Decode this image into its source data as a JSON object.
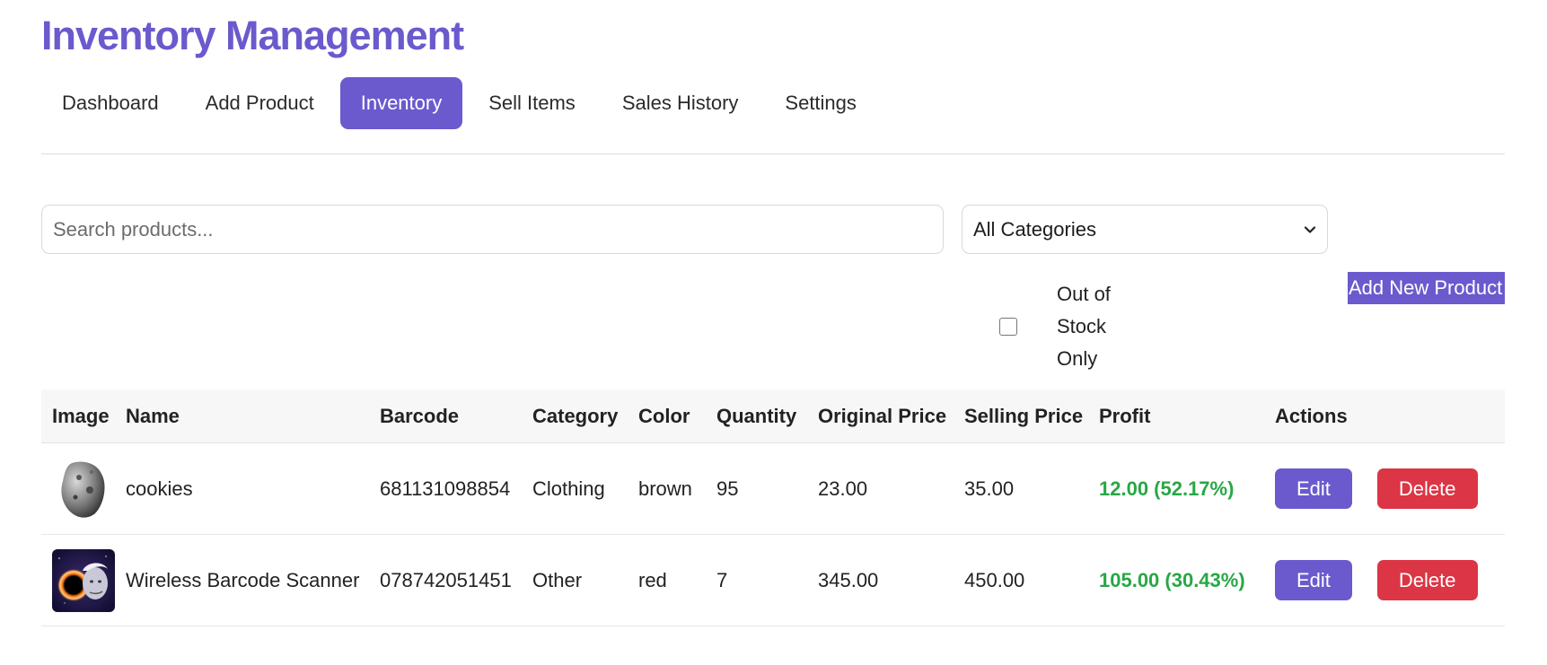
{
  "header": {
    "title": "Inventory Management"
  },
  "nav": {
    "items": [
      "Dashboard",
      "Add Product",
      "Inventory",
      "Sell Items",
      "Sales History",
      "Settings"
    ],
    "active_index": 2
  },
  "filters": {
    "search_placeholder": "Search products...",
    "category_selected": "All Categories",
    "out_of_stock_label": "Out of Stock Only",
    "out_of_stock_checked": false
  },
  "actions": {
    "add_new_label": "Add New Product"
  },
  "table": {
    "headers": [
      "Image",
      "Name",
      "Barcode",
      "Category",
      "Color",
      "Quantity",
      "Original Price",
      "Selling Price",
      "Profit",
      "Actions"
    ],
    "rows": [
      {
        "image_icon": "asteroid-image",
        "name": "cookies",
        "barcode": "681131098854",
        "category": "Clothing",
        "color": "brown",
        "quantity": "95",
        "original_price": "23.00",
        "selling_price": "35.00",
        "profit": "12.00 (52.17%)",
        "edit_label": "Edit",
        "delete_label": "Delete"
      },
      {
        "image_icon": "einstein-blackhole-image",
        "name": "Wireless Barcode Scanner",
        "barcode": "078742051451",
        "category": "Other",
        "color": "red",
        "quantity": "7",
        "original_price": "345.00",
        "selling_price": "450.00",
        "profit": "105.00 (30.43%)",
        "edit_label": "Edit",
        "delete_label": "Delete"
      }
    ]
  },
  "colors": {
    "accent": "#6a5acd",
    "danger": "#dc3545",
    "profit": "#28a745"
  }
}
